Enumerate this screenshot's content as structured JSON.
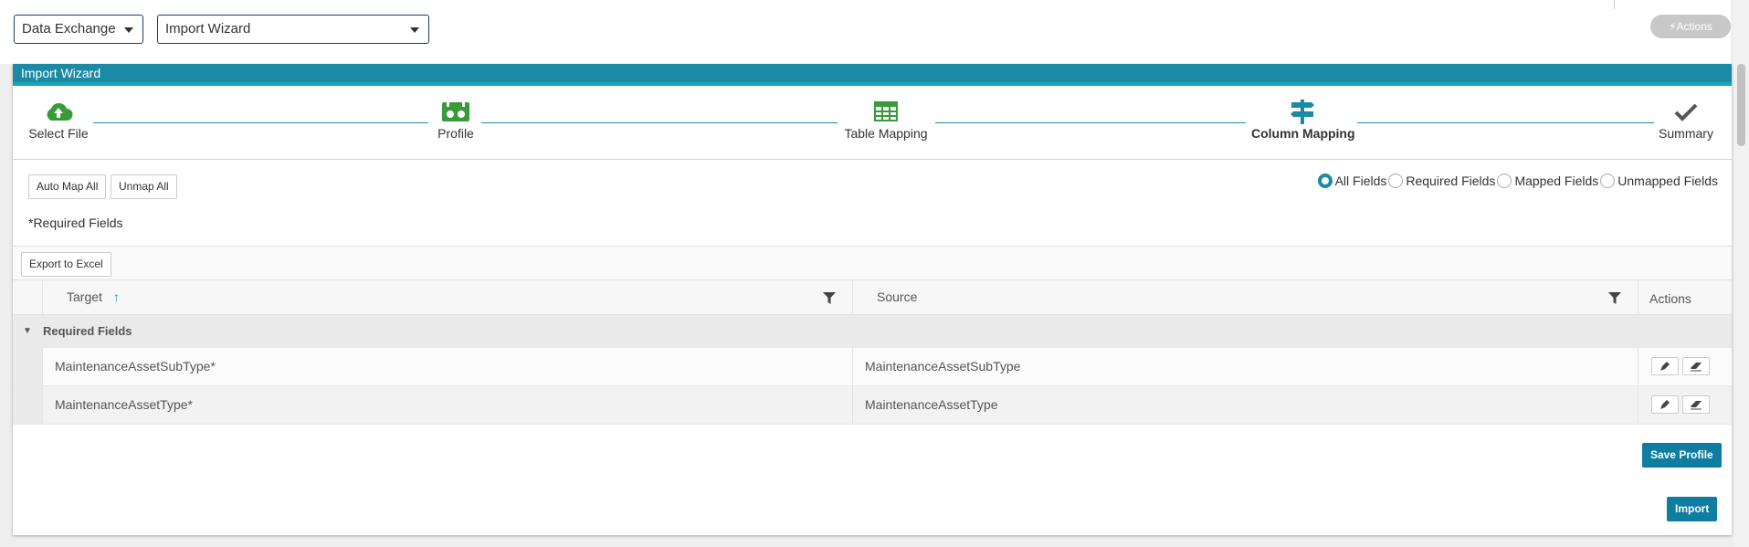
{
  "topbar": {
    "module_select": "Data Exchange",
    "page_select": "Import Wizard",
    "actions_label": "Actions"
  },
  "panel": {
    "title": "Import Wizard"
  },
  "wizard": {
    "steps": [
      {
        "label": "Select File",
        "icon": "cloud-upload-icon",
        "active": false
      },
      {
        "label": "Profile",
        "icon": "profile-icon",
        "active": false
      },
      {
        "label": "Table Mapping",
        "icon": "table-icon",
        "active": false
      },
      {
        "label": "Column Mapping",
        "icon": "signpost-icon",
        "active": true
      },
      {
        "label": "Summary",
        "icon": "check-icon",
        "active": false
      }
    ]
  },
  "toolbar": {
    "auto_map_all": "Auto Map All",
    "unmap_all": "Unmap All",
    "required_note": "*Required Fields",
    "export_excel": "Export to Excel"
  },
  "filters": {
    "options": [
      "All Fields",
      "Required Fields",
      "Mapped Fields",
      "Unmapped Fields"
    ],
    "selected": "All Fields"
  },
  "grid": {
    "columns": {
      "target": "Target",
      "source": "Source",
      "actions": "Actions"
    },
    "sort": "ascending",
    "group_label": "Required Fields",
    "rows": [
      {
        "target": "MaintenanceAssetSubType*",
        "source": "MaintenanceAssetSubType"
      },
      {
        "target": "MaintenanceAssetType*",
        "source": "MaintenanceAssetType"
      }
    ]
  },
  "footer": {
    "save_profile": "Save Profile",
    "import": "Import"
  },
  "colors": {
    "accent": "#1c8aa4",
    "step_green": "#3a9a3a",
    "primary_button": "#0f7da0"
  }
}
